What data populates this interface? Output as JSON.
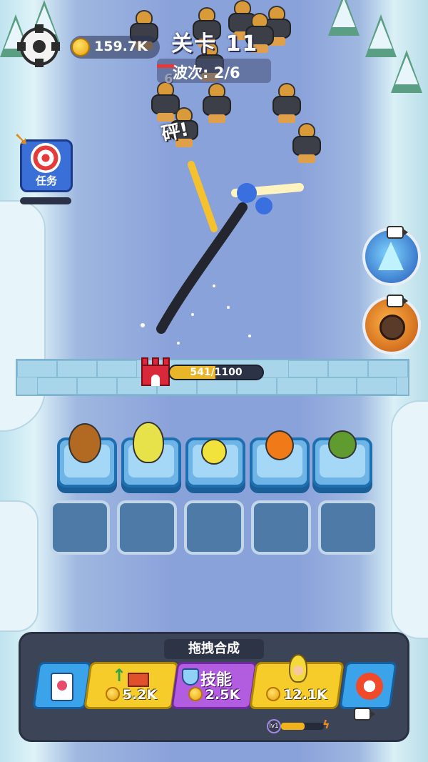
{
  "hud": {
    "coins": "159.7K",
    "level_label": "关卡 11",
    "wave_label": "波次: 2/6"
  },
  "task": {
    "label": "任务",
    "progress": 0
  },
  "floating_text": {
    "hit": "砰!",
    "damage": "6"
  },
  "wall": {
    "hp_current": 541,
    "hp_max": 1100,
    "hp_text": "541/1100"
  },
  "bottom_panel": {
    "title": "拖拽合成",
    "upgrade_wall_price": "5.2K",
    "skill_label": "技能",
    "skill_price": "2.5K",
    "hero_price": "12.1K",
    "hero_level": "lv1",
    "hero_level_progress": 0.55
  },
  "colors": {
    "wall_hp_fill": "#e8b628",
    "gold_button": "#f6cc2a",
    "skill_button": "#b25ce0",
    "blue_button": "#3aa3ea"
  },
  "icons": [
    "gear-icon",
    "coin-icon",
    "target-icon",
    "crystal-icon",
    "meteor-icon",
    "video-icon",
    "card-icon",
    "castle-upgrade-icon",
    "fist-fire-icon"
  ]
}
